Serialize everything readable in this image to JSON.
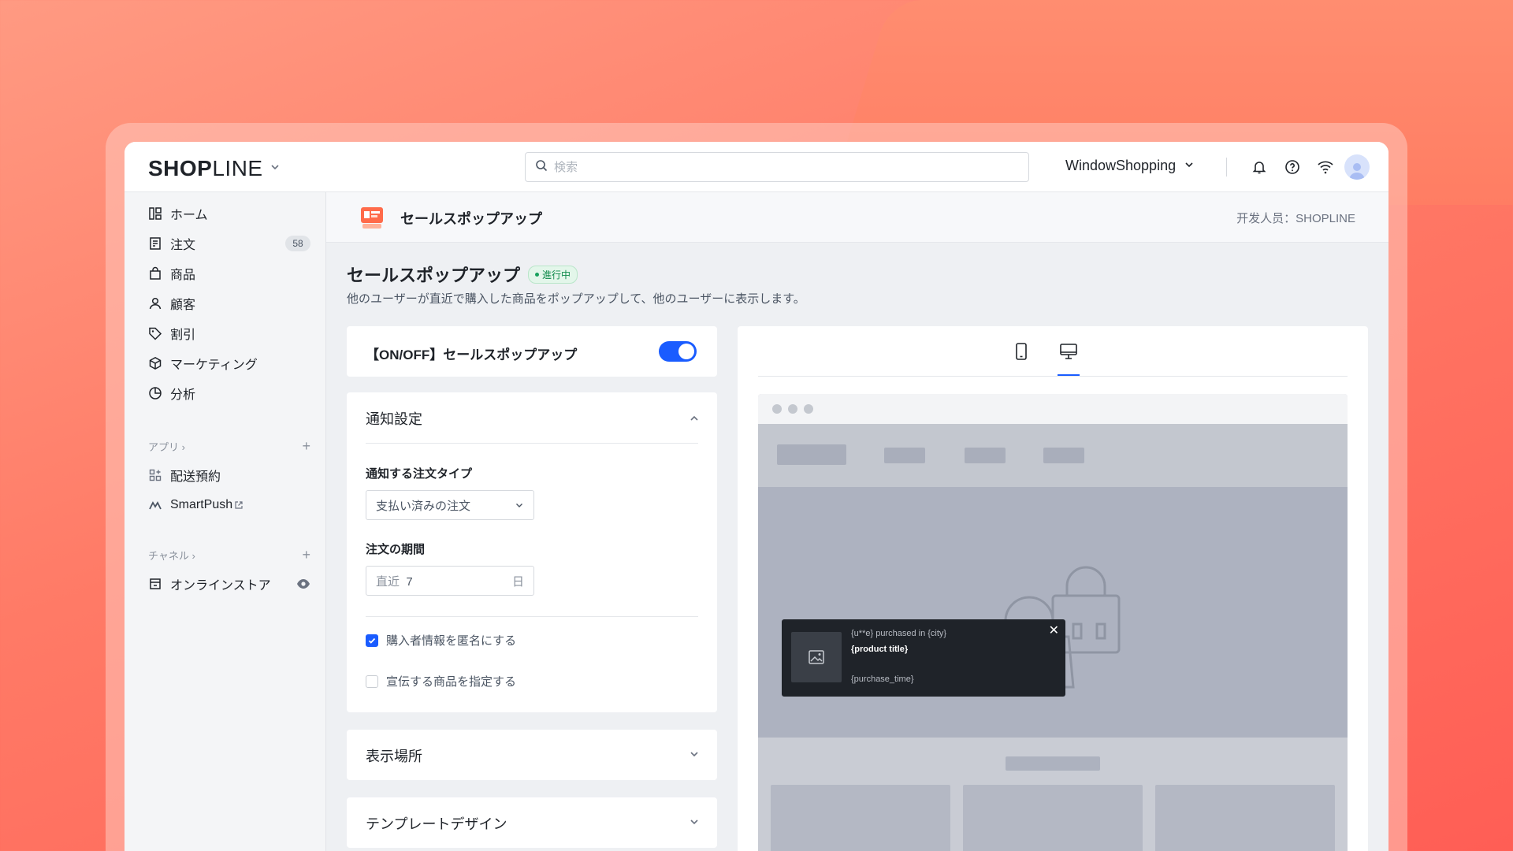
{
  "topbar": {
    "logo_bold": "SHOP",
    "logo_light": "LINE",
    "search_placeholder": "検索",
    "store_name": "WindowShopping"
  },
  "sidebar": {
    "items": [
      {
        "label": "ホーム",
        "icon": "home-icon"
      },
      {
        "label": "注文",
        "icon": "orders-icon",
        "badge": "58"
      },
      {
        "label": "商品",
        "icon": "bag-icon"
      },
      {
        "label": "顧客",
        "icon": "user-icon"
      },
      {
        "label": "割引",
        "icon": "tag-icon"
      },
      {
        "label": "マーケティング",
        "icon": "cube-icon"
      },
      {
        "label": "分析",
        "icon": "chart-icon"
      }
    ],
    "apps_header": "アプリ",
    "apps": [
      {
        "label": "配送預約",
        "icon": "apps-icon"
      },
      {
        "label": "SmartPush",
        "icon": "smartpush-icon"
      }
    ],
    "channels_header": "チャネル",
    "channels": [
      {
        "label": "オンラインストア",
        "icon": "store-icon"
      }
    ]
  },
  "page_header": {
    "title": "セールスポップアップ",
    "developer": "开发人员：SHOPLINE"
  },
  "content": {
    "title": "セールスポップアップ",
    "status": "進行中",
    "status_color": "#17a05c",
    "description": "他のユーザーが直近で購入した商品をポップアップして、他のユーザーに表示します。"
  },
  "toggle_card": {
    "label": "【ON/OFF】セールスポップアップ",
    "enabled": true,
    "accent": "#1a5cff"
  },
  "notification_settings": {
    "header": "通知設定",
    "order_type_label": "通知する注文タイプ",
    "order_type_value": "支払い済みの注文",
    "period_label": "注文の期間",
    "period_prefix": "直近",
    "period_value": "7",
    "period_unit": "日",
    "anonymize_label": "購入者情報を匿名にする",
    "anonymize_checked": true,
    "specify_products_label": "宣伝する商品を指定する",
    "specify_products_checked": false
  },
  "display_location": {
    "header": "表示場所"
  },
  "template_design": {
    "header": "テンプレートデザイン"
  },
  "preview": {
    "active_device": "desktop",
    "popup": {
      "line1": "{u**e} purchased in {city}",
      "line2": "{product title}",
      "line3": "{purchase_time}"
    }
  }
}
